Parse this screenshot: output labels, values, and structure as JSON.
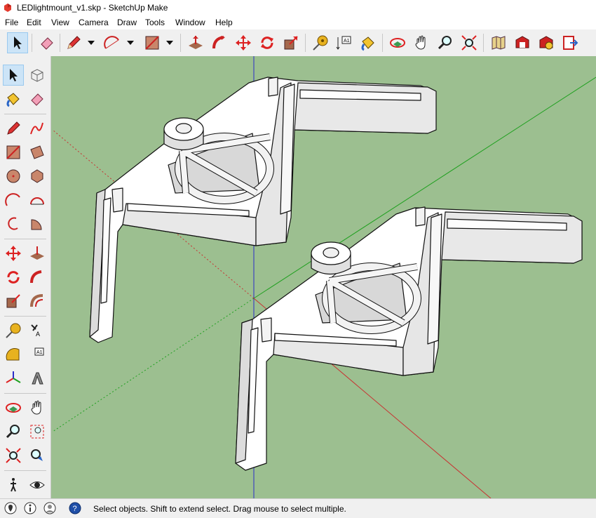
{
  "window": {
    "title": "LEDlightmount_v1.skp - SketchUp Make"
  },
  "menu": [
    "File",
    "Edit",
    "View",
    "Camera",
    "Draw",
    "Tools",
    "Window",
    "Help"
  ],
  "status": {
    "message": "Select objects. Shift to extend select. Drag mouse to select multiple."
  },
  "colors": {
    "viewport_bg": "#9cbf90",
    "axis_red": "#c83232",
    "axis_green": "#1fa01f",
    "axis_blue": "#2c2cc8",
    "model_fill": "#ffffff"
  }
}
